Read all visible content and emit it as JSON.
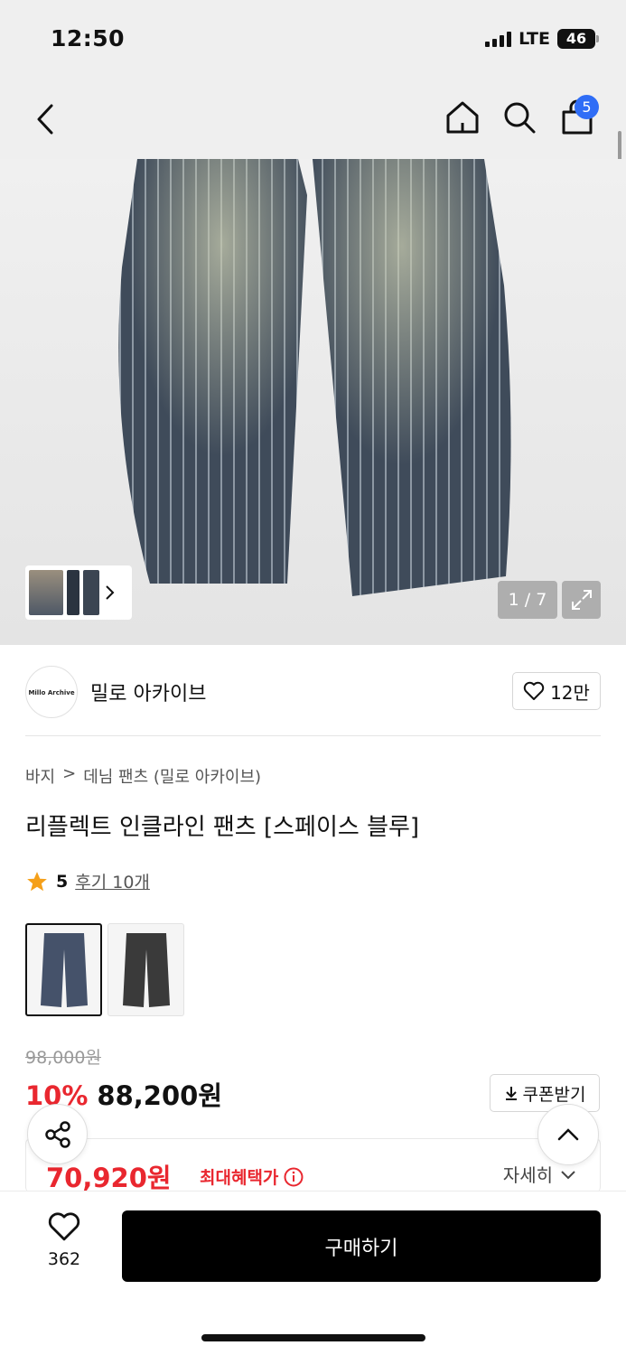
{
  "status_bar": {
    "time": "12:50",
    "network": "LTE",
    "battery": "46"
  },
  "nav": {
    "cart_count": "5"
  },
  "gallery": {
    "counter": "1 / 7"
  },
  "brand": {
    "logo_text": "Millo Archive",
    "name": "밀로 아카이브",
    "likes": "12만"
  },
  "breadcrumb": {
    "items": [
      "바지",
      "데님 팬츠 (밀로 아카이브)"
    ]
  },
  "product": {
    "title": "리플렉트 인클라인 팬츠 [스페이스 블루]",
    "rating": "5",
    "reviews": "후기 10개",
    "original_price": "98,000원",
    "discount": "10%",
    "price": "88,200원",
    "coupon_label": "쿠폰받기",
    "max_benefit_price": "70,920원",
    "max_benefit_label": "최대혜택가",
    "detail_label": "자세히"
  },
  "bottom": {
    "wish_count": "362",
    "buy_label": "구매하기"
  },
  "colors": {
    "accent_red": "#e9272f",
    "badge_blue": "#2f6df6",
    "star": "#f5a01a"
  }
}
